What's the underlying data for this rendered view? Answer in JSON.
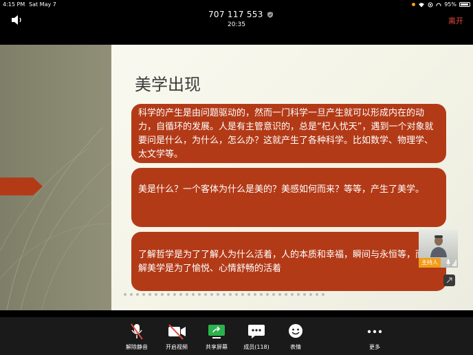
{
  "status_bar": {
    "time": "4:15 PM",
    "date": "Sat May 7",
    "battery": "95%"
  },
  "meeting": {
    "id": "707 117 553",
    "elapsed": "20:35",
    "leave_label": "离开"
  },
  "slide": {
    "title": "美学出现",
    "paragraphs": [
      "科学的产生是由问题驱动的，然而一门科学一旦产生就可以形成内在的动力，自循环的发展。人是有主管意识的，总是“杞人忧天”，遇到一个对象就要问是什么，为什么，怎么办？这就产生了各种科学。比如数学、物理学、太文学等。",
      "美是什么？一个客体为什么是美的？美感如何而来？等等，产生了美学。",
      "了解哲学是为了了解人为什么活着，人的本质和幸福，瞬间与永恒等，而了解美学是为了愉悦、心情舒畅的活着"
    ],
    "accent_color": "#b33a17"
  },
  "participant": {
    "role_label": "主持人"
  },
  "toolbar": {
    "items": [
      {
        "label": "解除静音",
        "icon": "mic-muted-icon"
      },
      {
        "label": "开启视频",
        "icon": "video-off-icon"
      },
      {
        "label": "共享屏幕",
        "icon": "share-screen-icon"
      },
      {
        "label": "成员(118)",
        "icon": "participants-icon"
      },
      {
        "label": "表情",
        "icon": "emoji-icon"
      },
      {
        "label": "更多",
        "icon": "more-icon"
      }
    ]
  },
  "colors": {
    "leave": "#e5483d",
    "host_badge": "#f29d18",
    "share_green": "#2bb24c"
  }
}
